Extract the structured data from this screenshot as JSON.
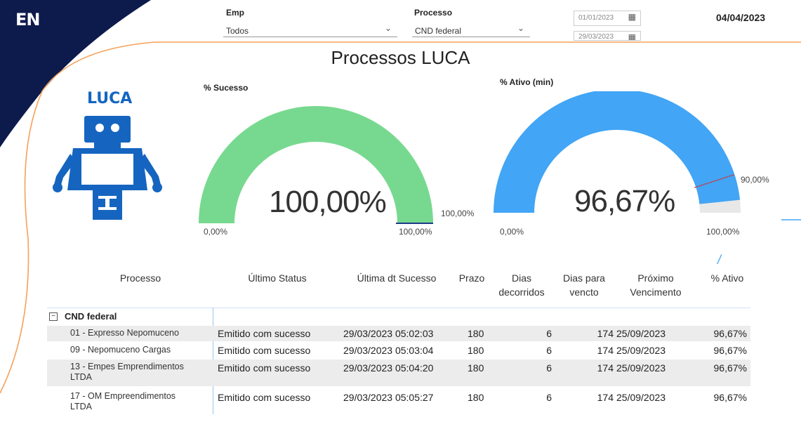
{
  "logo_text": "EN",
  "filters": {
    "emp_label": "Emp",
    "emp_value": "Todos",
    "processo_label": "Processo",
    "processo_value": "CND federal",
    "date_start": "01/01/2023",
    "date_end": "29/03/2023"
  },
  "current_date": "04/04/2023",
  "title": "Processos LUCA",
  "robot_label": "LUCA",
  "gauges": {
    "sucesso": {
      "title": "% Sucesso",
      "value": "100,00%",
      "min": "0,00%",
      "max": "100,00%",
      "target": "100,00%",
      "fraction": 1.0,
      "color": "#77d98f"
    },
    "ativo": {
      "title": "% Ativo (min)",
      "value": "96,67%",
      "min": "0,00%",
      "max": "100,00%",
      "target": "90,00%",
      "fraction": 0.9667,
      "target_fraction": 0.9,
      "color": "#42a5f5"
    }
  },
  "table": {
    "headers": {
      "processo": "Processo",
      "ultimo_status": "Último Status",
      "ultima_dt": "Última dt Sucesso",
      "prazo": "Prazo",
      "dias_decorridos_1": "Dias",
      "dias_decorridos_2": "decorridos",
      "dias_para_1": "Dias para",
      "dias_para_2": "vencto",
      "proximo_1": "Próximo",
      "proximo_2": "Vencimento",
      "ativo": "% Ativo"
    },
    "group": "CND federal",
    "rows": [
      {
        "name1": "01 - Expresso Nepomuceno",
        "name2": "",
        "status": "Emitido com sucesso",
        "dt": "29/03/2023 05:02:03",
        "prazo": "180",
        "decorridos": "6",
        "para": "174",
        "proximo": "25/09/2023",
        "ativo": "96,67%"
      },
      {
        "name1": "09 - Nepomuceno Cargas",
        "name2": "",
        "status": "Emitido com sucesso",
        "dt": "29/03/2023 05:03:04",
        "prazo": "180",
        "decorridos": "6",
        "para": "174",
        "proximo": "25/09/2023",
        "ativo": "96,67%"
      },
      {
        "name1": "13 - Empes Emprendimentos",
        "name2": "LTDA",
        "status": "Emitido com sucesso",
        "dt": "29/03/2023 05:04:20",
        "prazo": "180",
        "decorridos": "6",
        "para": "174",
        "proximo": "25/09/2023",
        "ativo": "96,67%"
      },
      {
        "name1": "17 - OM Empreendimentos",
        "name2": "LTDA",
        "status": "Emitido com sucesso",
        "dt": "29/03/2023 05:05:27",
        "prazo": "180",
        "decorridos": "6",
        "para": "174",
        "proximo": "25/09/2023",
        "ativo": "96,67%"
      }
    ]
  },
  "colors": {
    "navy": "#0d1b4c",
    "orange": "#f5a15a",
    "robot": "#1565c0"
  }
}
